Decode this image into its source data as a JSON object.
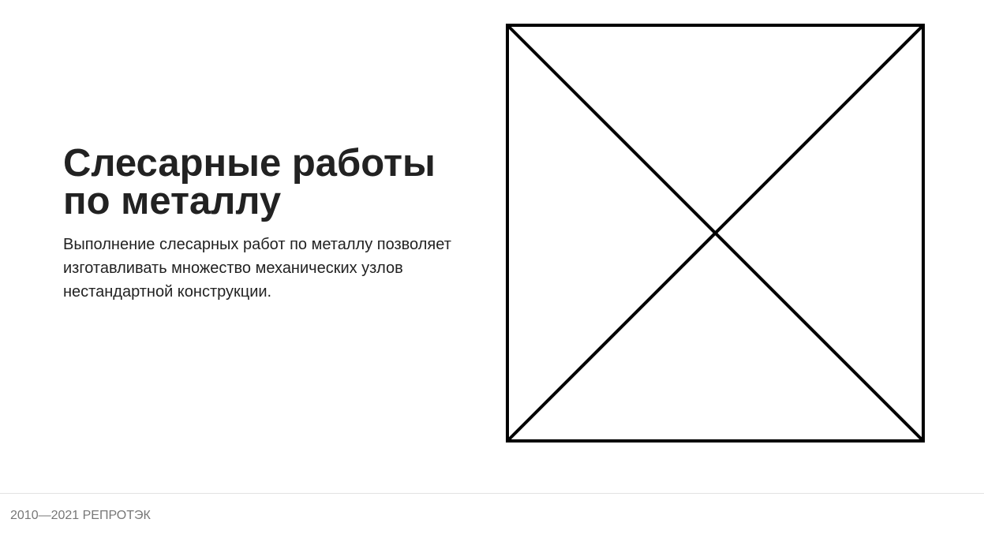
{
  "hero": {
    "title_line1": "Слесарные работы",
    "title_line2": "по металлу",
    "description": "Выполнение слесарных работ по металлу позволяет изготавливать множество механических узлов нестандартной конструкции."
  },
  "image": {
    "icon": "image-placeholder-icon"
  },
  "footer": {
    "copyright": "2010—2021 РЕПРОТЭК"
  },
  "colors": {
    "heading": "#222222",
    "text": "#222222",
    "footer_text": "#777777",
    "divider": "#e2e2e2",
    "placeholder_stroke": "#000000"
  }
}
